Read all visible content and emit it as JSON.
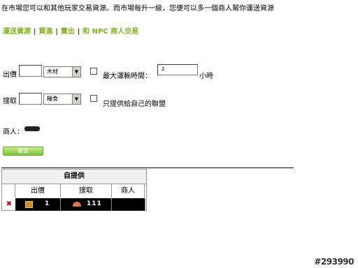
{
  "intro": "在市場您可以和其他玩家交易資源。而市場每升一級，您便可以多一個商人幫你運送資源",
  "nav": {
    "send": "運送資源",
    "buy": "買進",
    "sell": "賣出",
    "npc": "和 NPC 商人交易",
    "sep": "|"
  },
  "form": {
    "offer_label": "出價",
    "offer_amount": "",
    "offer_resource": "木材",
    "max_time_label": "最大運輸時間：",
    "max_time_value": "2",
    "hours_unit": "小時",
    "search_label": "搜取",
    "search_amount": "",
    "search_resource": "糧食",
    "alliance_only_label": "只提供給自己的聯盟",
    "merchants_label": "商人："
  },
  "submit_label": "確定",
  "offers_table": {
    "caption": "自提供",
    "headers": [
      "出價",
      "搜取",
      "商人"
    ],
    "rows": [
      {
        "delete_glyph": "✖",
        "offer_value": "1",
        "search_value": "111",
        "merchants": ""
      }
    ]
  },
  "watermark": "#293990",
  "colors": {
    "nav_link": "#7fb61a",
    "button_top": "#c8ee8a",
    "button_bottom": "#7cc23a",
    "delete_red": "#cc0000"
  }
}
